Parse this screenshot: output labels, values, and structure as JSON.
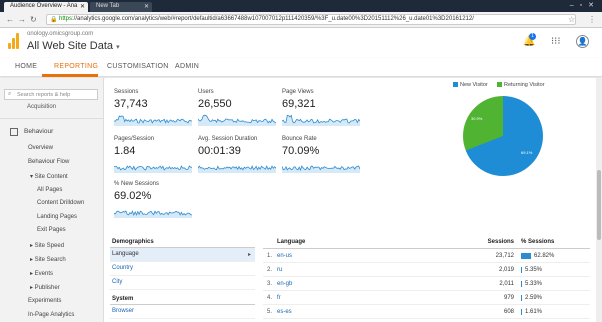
{
  "browser": {
    "tabs": [
      {
        "label": "Audience Overview - Ana"
      },
      {
        "label": "New Tab"
      }
    ],
    "url_scheme": "https",
    "url_rest": "://analytics.google.com/analytics/web/#report/defaultid/a63667488w107007012p111420359/%3F_u.date00%3D20151112%26_u.date01%3D20161212/"
  },
  "header": {
    "account": "onology.omicsgroup.com",
    "property": "All Web Site Data",
    "notification_count": "1"
  },
  "nav_tabs": [
    "HOME",
    "REPORTING",
    "CUSTOMISATION",
    "ADMIN"
  ],
  "sidebar": {
    "search_placeholder": "Search reports & help",
    "acquisition": "Acquisition",
    "behaviour": "Behaviour",
    "items": [
      "Overview",
      "Behaviour Flow",
      "▾ Site Content",
      "All Pages",
      "Content Drilldown",
      "Landing Pages",
      "Exit Pages",
      "▸ Site Speed",
      "▸ Site Search",
      "▸ Events",
      "▸ Publisher",
      "Experiments",
      "In-Page Analytics"
    ]
  },
  "metrics": [
    {
      "label": "Sessions",
      "value": "37,743"
    },
    {
      "label": "Users",
      "value": "26,550"
    },
    {
      "label": "Page Views",
      "value": "69,321"
    },
    {
      "label": "Pages/Session",
      "value": "1.84"
    },
    {
      "label": "Avg. Session Duration",
      "value": "00:01:39"
    },
    {
      "label": "Bounce Rate",
      "value": "70.09%"
    },
    {
      "label": "% New Sessions",
      "value": "69.02%"
    }
  ],
  "pie": {
    "legend": [
      {
        "label": "New Visitor",
        "color": "#1f8dd6"
      },
      {
        "label": "Returning Visitor",
        "color": "#50b432"
      }
    ],
    "slices": [
      {
        "label": "New Visitor",
        "value": 69.1,
        "text": "69.1%",
        "color": "#1f8dd6"
      },
      {
        "label": "Returning Visitor",
        "value": 30.9,
        "text": "30.9%",
        "color": "#50b432"
      }
    ]
  },
  "demographics": {
    "header": "Demographics",
    "rows": [
      "Language",
      "Country",
      "City"
    ],
    "system_header": "System",
    "system_rows": [
      "Browser"
    ]
  },
  "language_table": {
    "header_language": "Language",
    "header_sessions": "Sessions",
    "header_pct": "% Sessions",
    "rows": [
      {
        "num": "1.",
        "code": "en-us",
        "sessions": "23,712",
        "pct": "62.82%",
        "pct_value": 62.82
      },
      {
        "num": "2.",
        "code": "ru",
        "sessions": "2,019",
        "pct": "5.35%",
        "pct_value": 5.35
      },
      {
        "num": "3.",
        "code": "en-gb",
        "sessions": "2,011",
        "pct": "5.33%",
        "pct_value": 5.33
      },
      {
        "num": "4.",
        "code": "fr",
        "sessions": "979",
        "pct": "2.59%",
        "pct_value": 2.59
      },
      {
        "num": "5.",
        "code": "es-es",
        "sessions": "608",
        "pct": "1.61%",
        "pct_value": 1.61
      }
    ]
  }
}
